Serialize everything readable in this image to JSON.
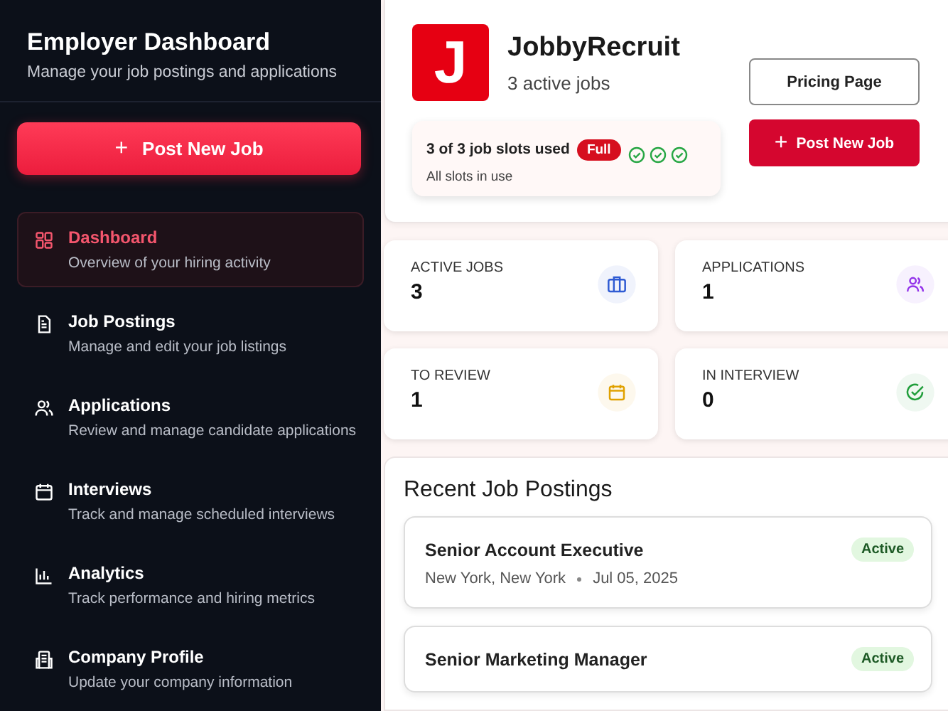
{
  "sidebar": {
    "title": "Employer Dashboard",
    "subtitle": "Manage your job postings and applications",
    "post_button": {
      "icon": "+",
      "label": "Post New Job"
    },
    "items": [
      {
        "kind": "dashboard",
        "label": "Dashboard",
        "description": "Overview of your hiring activity",
        "selected": true
      },
      {
        "kind": "document",
        "label": "Job Postings",
        "description": "Manage and edit your job listings",
        "selected": false
      },
      {
        "kind": "users",
        "label": "Applications",
        "description": "Review and manage candidate applications",
        "selected": false
      },
      {
        "kind": "calendar",
        "label": "Interviews",
        "description": "Track and manage scheduled interviews",
        "selected": false
      },
      {
        "kind": "chart",
        "label": "Analytics",
        "description": "Track performance and hiring metrics",
        "selected": false
      },
      {
        "kind": "building",
        "label": "Company Profile",
        "description": "Update your company information",
        "selected": false
      }
    ]
  },
  "company": {
    "logo_letter": "J",
    "name": "JobbyRecruit",
    "active_jobs": "3 active jobs",
    "slots": {
      "text": "3 of 3 job slots used",
      "badge": "Full",
      "note": "All slots in use",
      "slots": [
        {
          "filled": true
        },
        {
          "filled": true
        },
        {
          "filled": true
        }
      ]
    },
    "pricing_button": "Pricing Page",
    "post_button": {
      "icon": "+",
      "label": "Post New Job"
    }
  },
  "stats": [
    {
      "kind": "briefcase",
      "label": "ACTIVE JOBS",
      "value": "3",
      "color": "#2f5bd3"
    },
    {
      "kind": "users",
      "label": "APPLICATIONS",
      "value": "1",
      "color": "#9333ea"
    },
    {
      "kind": "calendar",
      "label": "TO REVIEW",
      "value": "1",
      "color": "#e0a100"
    },
    {
      "kind": "check",
      "label": "IN INTERVIEW",
      "value": "0",
      "color": "#1f9d3a"
    }
  ],
  "recent": {
    "title": "Recent Job Postings",
    "jobs": [
      {
        "title": "Senior Account Executive",
        "location": "New York, New York",
        "date": "Jul 05, 2025",
        "status": "Active"
      },
      {
        "title": "Senior Marketing Manager",
        "status": "Active"
      }
    ]
  }
}
